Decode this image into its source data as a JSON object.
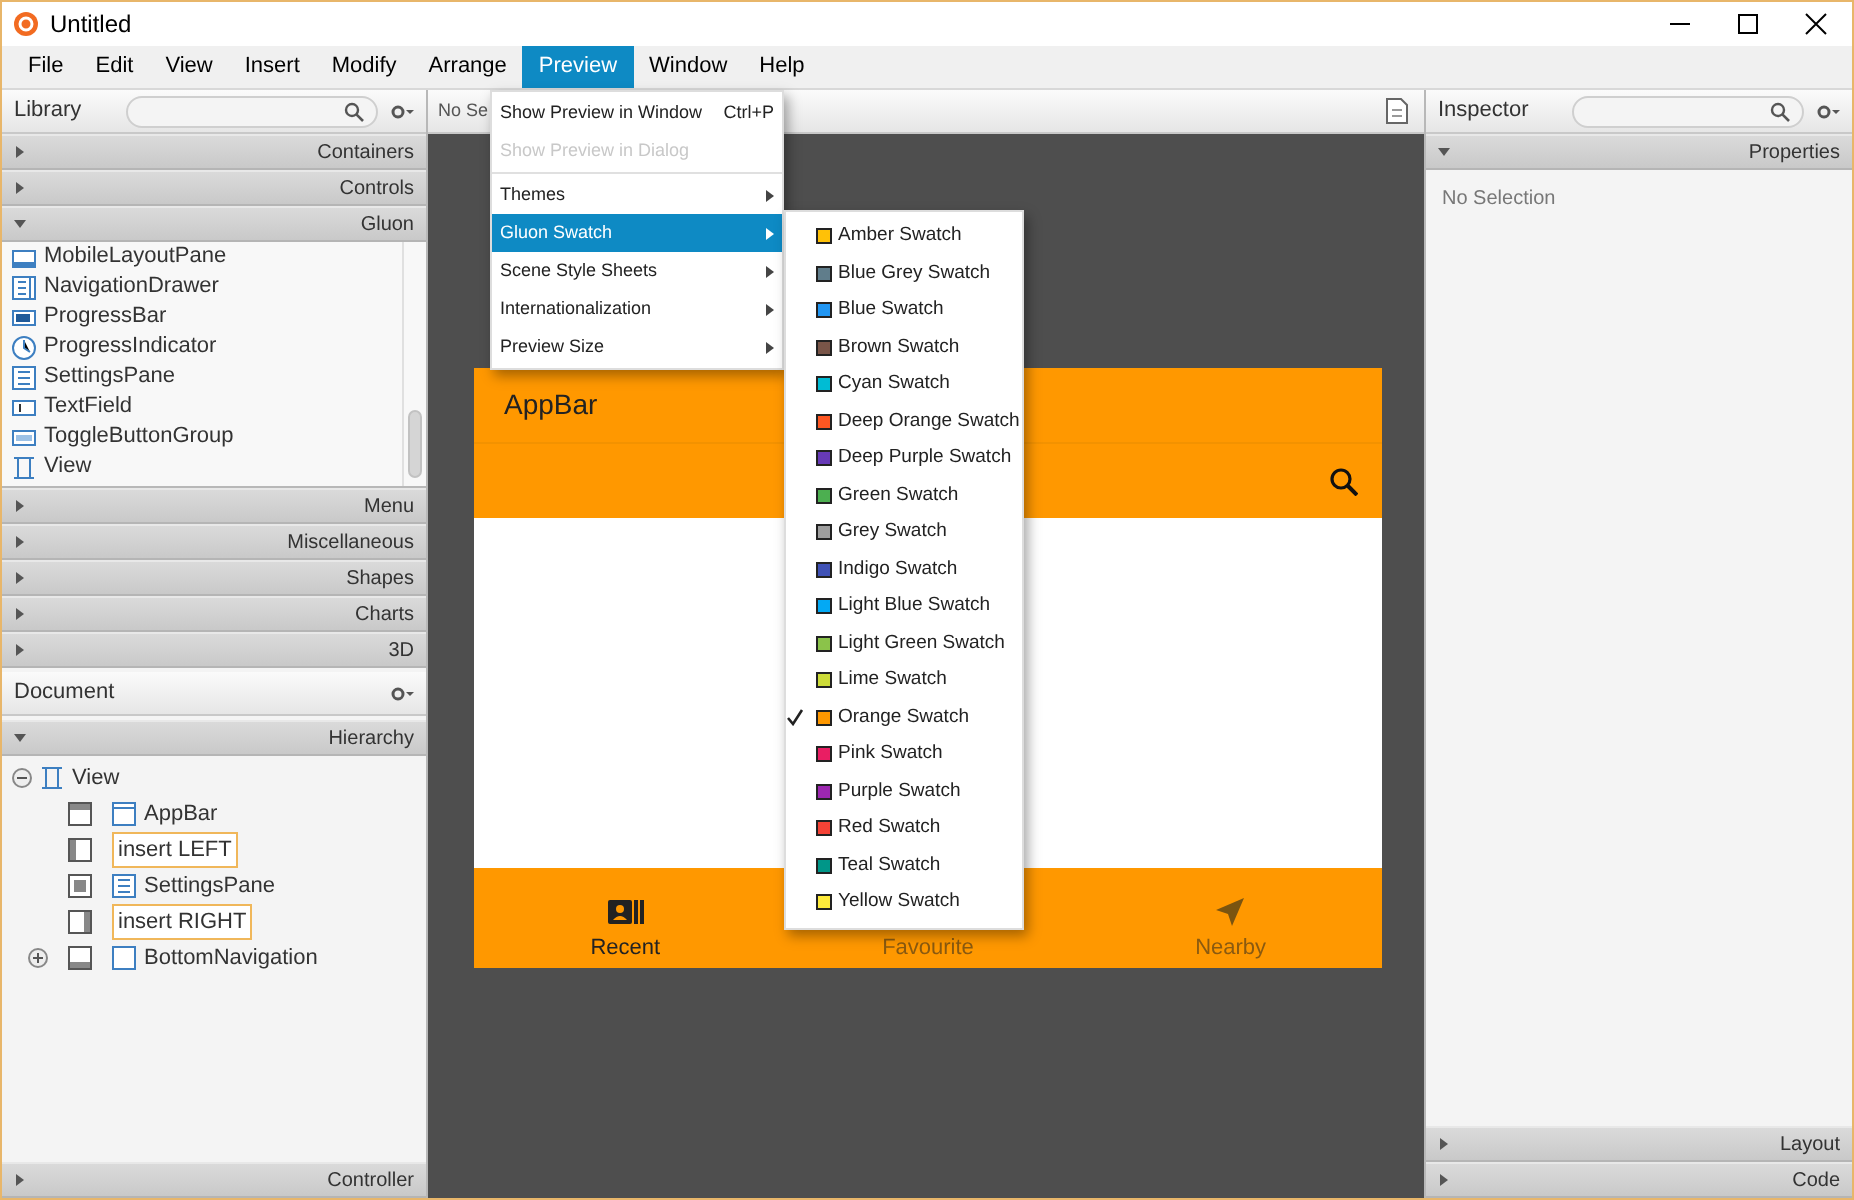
{
  "window": {
    "title": "Untitled"
  },
  "menu_bar": [
    {
      "label": "File",
      "selected": false
    },
    {
      "label": "Edit",
      "selected": false
    },
    {
      "label": "View",
      "selected": false
    },
    {
      "label": "Insert",
      "selected": false
    },
    {
      "label": "Modify",
      "selected": false
    },
    {
      "label": "Arrange",
      "selected": false
    },
    {
      "label": "Preview",
      "selected": true
    },
    {
      "label": "Window",
      "selected": false
    },
    {
      "label": "Help",
      "selected": false
    }
  ],
  "preview_menu": [
    {
      "kind": "item",
      "label": "Show Preview in Window",
      "shortcut": "Ctrl+P",
      "disabled": false
    },
    {
      "kind": "item",
      "label": "Show Preview in Dialog",
      "disabled": true
    },
    {
      "kind": "separator"
    },
    {
      "kind": "submenu",
      "label": "Themes",
      "selected": false
    },
    {
      "kind": "submenu",
      "label": "Gluon Swatch",
      "selected": true
    },
    {
      "kind": "submenu",
      "label": "Scene Style Sheets",
      "selected": false
    },
    {
      "kind": "submenu",
      "label": "Internationalization",
      "selected": false
    },
    {
      "kind": "submenu",
      "label": "Preview Size",
      "selected": false
    }
  ],
  "swatch_menu": [
    {
      "label": "Amber Swatch",
      "color": "#ffc107",
      "checked": false
    },
    {
      "label": "Blue Grey Swatch",
      "color": "#607d8b",
      "checked": false
    },
    {
      "label": "Blue Swatch",
      "color": "#2196f3",
      "checked": false
    },
    {
      "label": "Brown Swatch",
      "color": "#795548",
      "checked": false
    },
    {
      "label": "Cyan Swatch",
      "color": "#00bcd4",
      "checked": false
    },
    {
      "label": "Deep Orange Swatch",
      "color": "#ff5722",
      "checked": false
    },
    {
      "label": "Deep Purple Swatch",
      "color": "#673ab7",
      "checked": false
    },
    {
      "label": "Green Swatch",
      "color": "#4caf50",
      "checked": false
    },
    {
      "label": "Grey Swatch",
      "color": "#9e9e9e",
      "checked": false
    },
    {
      "label": "Indigo Swatch",
      "color": "#3f51b5",
      "checked": false
    },
    {
      "label": "Light Blue Swatch",
      "color": "#03a9f4",
      "checked": false
    },
    {
      "label": "Light Green Swatch",
      "color": "#8bc34a",
      "checked": false
    },
    {
      "label": "Lime Swatch",
      "color": "#cddc39",
      "checked": false
    },
    {
      "label": "Orange Swatch",
      "color": "#ff9800",
      "checked": true
    },
    {
      "label": "Pink Swatch",
      "color": "#e91e63",
      "checked": false
    },
    {
      "label": "Purple Swatch",
      "color": "#9c27b0",
      "checked": false
    },
    {
      "label": "Red Swatch",
      "color": "#f44336",
      "checked": false
    },
    {
      "label": "Teal Swatch",
      "color": "#009688",
      "checked": false
    },
    {
      "label": "Yellow Swatch",
      "color": "#ffeb3b",
      "checked": false
    }
  ],
  "library": {
    "title": "Library",
    "sections_top": [
      {
        "label": "Containers",
        "expanded": false
      },
      {
        "label": "Controls",
        "expanded": false
      },
      {
        "label": "Gluon",
        "expanded": true
      }
    ],
    "items": [
      "MobileLayoutPane",
      "NavigationDrawer",
      "ProgressBar",
      "ProgressIndicator",
      "SettingsPane",
      "TextField",
      "ToggleButtonGroup",
      "View"
    ],
    "sections_bottom": [
      {
        "label": "Menu",
        "expanded": false
      },
      {
        "label": "Miscellaneous",
        "expanded": false
      },
      {
        "label": "Shapes",
        "expanded": false
      },
      {
        "label": "Charts",
        "expanded": false
      },
      {
        "label": "3D",
        "expanded": false
      }
    ]
  },
  "document": {
    "title": "Document",
    "hierarchy": {
      "label": "Hierarchy",
      "expanded": true
    },
    "tree": [
      {
        "label": "View",
        "kind": "node",
        "expanded": true,
        "children": [
          {
            "label": "AppBar",
            "kind": "node"
          },
          {
            "label": "insert LEFT",
            "kind": "slot"
          },
          {
            "label": "SettingsPane",
            "kind": "node"
          },
          {
            "label": "insert RIGHT",
            "kind": "slot"
          },
          {
            "label": "BottomNavigation",
            "kind": "node",
            "expanded": false
          }
        ]
      }
    ],
    "controller": {
      "label": "Controller",
      "expanded": false
    }
  },
  "canvas": {
    "toolbar_text": "No Se",
    "preview": {
      "app_bar_title": "AppBar",
      "bottom_navigation": [
        {
          "label": "Recent",
          "selected": true
        },
        {
          "label": "Favourite",
          "selected": false
        },
        {
          "label": "Nearby",
          "selected": false
        }
      ]
    }
  },
  "inspector": {
    "title": "Inspector",
    "properties": {
      "label": "Properties",
      "expanded": true
    },
    "empty_text": "No Selection",
    "sections": [
      {
        "label": "Layout",
        "expanded": false
      },
      {
        "label": "Code",
        "expanded": false
      }
    ]
  }
}
